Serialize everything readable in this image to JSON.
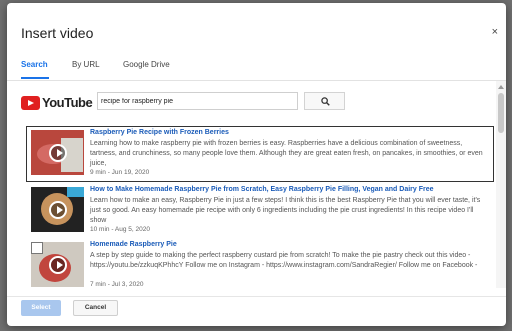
{
  "dialog": {
    "title": "Insert video",
    "close_glyph": "×"
  },
  "tabs": [
    {
      "label": "Search",
      "active": true
    },
    {
      "label": "By URL",
      "active": false
    },
    {
      "label": "Google Drive",
      "active": false
    }
  ],
  "search": {
    "logo_text": "YouTube",
    "query": "recipe for raspberry pie"
  },
  "results": [
    {
      "title": "Raspberry Pie Recipe with Frozen Berries",
      "description": "Learning how to make raspberry pie with frozen berries is easy. Raspberries have a delicious combination of sweetness, tartness, and crunchiness, so many people love them. Although they are great eaten fresh, on pancakes, in smoothies, or even juice,",
      "meta": "9 min - Jun 19, 2020",
      "selected": true
    },
    {
      "title": "How to Make Homemade Raspberry Pie from Scratch, Easy Raspberry Pie Filling, Vegan and Dairy Free",
      "description": "Learn how to make an easy, Raspberry Pie in just a few steps! I think this is the best Raspberry Pie that you will ever taste, it's just so good. An easy homemade pie recipe with only 6 ingredients including the pie crust ingredients! In this recipe video I'll show",
      "meta": "10 min - Aug 5, 2020",
      "selected": false
    },
    {
      "title": "Homemade Raspberry Pie",
      "description": "A step by step guide to making the perfect raspberry custard pie from scratch! To make the pie pastry check out this video - https://youtu.be/zzkuqKPhhcY Follow me on Instagram - https://www.instagram.com/SandraRegier/ Follow me on Facebook -",
      "meta": "7 min - Jul 3, 2020",
      "selected": false
    }
  ],
  "footer": {
    "select_label": "Select",
    "cancel_label": "Cancel"
  },
  "colors": {
    "accent": "#1a73e8",
    "youtube_red": "#e02020",
    "title_link": "#1a5bb8",
    "select_disabled": "#a9c7ee"
  }
}
